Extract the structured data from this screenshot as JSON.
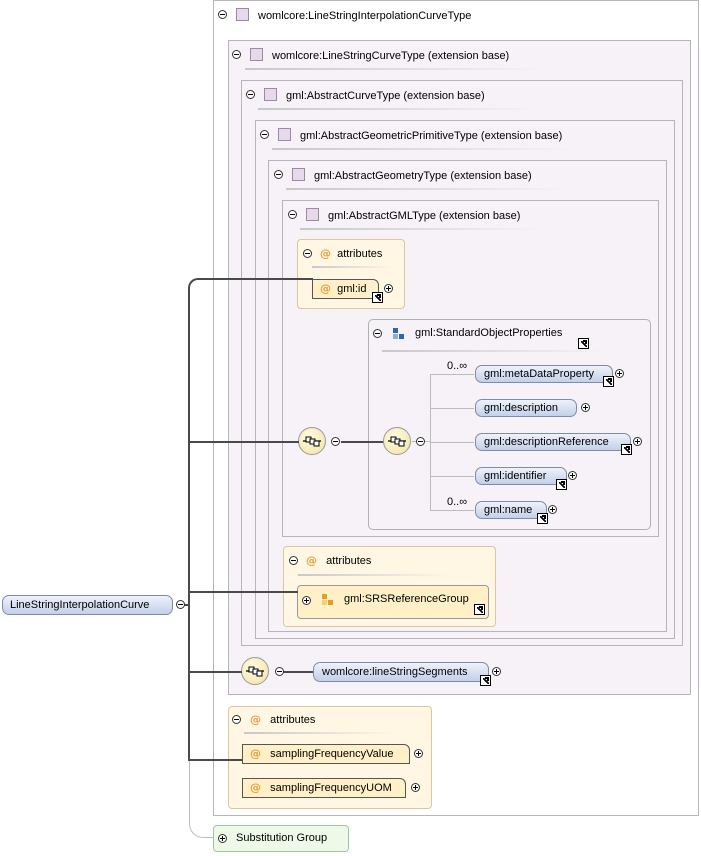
{
  "root_element": "LineStringInterpolationCurve",
  "types": {
    "interpolation_curve": "womlcore:LineStringInterpolationCurveType",
    "line_string_curve": "womlcore:LineStringCurveType (extension base)",
    "abstract_curve": "gml:AbstractCurveType (extension base)",
    "abstract_primitive": "gml:AbstractGeometricPrimitiveType (extension base)",
    "abstract_geometry": "gml:AbstractGeometryType (extension base)",
    "abstract_gml": "gml:AbstractGMLType (extension base)"
  },
  "attributes_label": "attributes",
  "gml_attributes": {
    "id": "gml:id"
  },
  "standard_object_properties": {
    "group": "gml:StandardObjectProperties",
    "elements": [
      {
        "name": "gml:metaDataProperty",
        "cardinality": "0..∞"
      },
      {
        "name": "gml:description",
        "cardinality": ""
      },
      {
        "name": "gml:descriptionReference",
        "cardinality": ""
      },
      {
        "name": "gml:identifier",
        "cardinality": ""
      },
      {
        "name": "gml:name",
        "cardinality": "0..∞"
      }
    ]
  },
  "geometry_attributes": {
    "group": "gml:SRSReferenceGroup"
  },
  "line_string_segments": "womlcore:lineStringSegments",
  "womlcore_attributes": [
    "samplingFrequencyValue",
    "samplingFrequencyUOM"
  ],
  "substitution_group": "Substitution Group",
  "icon_names": [
    "collapse-icon",
    "expand-icon",
    "type-square-icon",
    "attribute-at-icon",
    "sequence-compositor-icon",
    "link-arrow-icon",
    "attribute-group-icon",
    "model-group-icon"
  ],
  "colors": {
    "element_fill": "#c3d0e8",
    "attribute_fill": "#fff0c8",
    "type_fill": "#f7f1f8",
    "substitution_fill": "#eef9ea"
  }
}
